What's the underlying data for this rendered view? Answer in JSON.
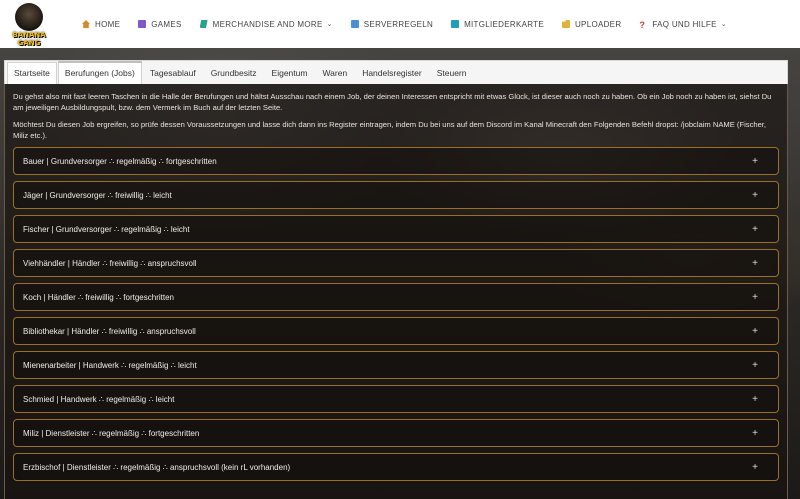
{
  "brand": {
    "logo_text": "BANANA GANG"
  },
  "nav": {
    "items": [
      {
        "label": "HOME",
        "icon": "home-icon"
      },
      {
        "label": "GAMES",
        "icon": "games-icon"
      },
      {
        "label": "MERCHANDISE AND MORE",
        "icon": "merch-icon",
        "dropdown": true
      },
      {
        "label": "SERVERREGELN",
        "icon": "rules-icon"
      },
      {
        "label": "MITGLIEDERKARTE",
        "icon": "map-icon"
      },
      {
        "label": "UPLOADER",
        "icon": "folder-icon"
      },
      {
        "label": "FAQ UND HILFE",
        "icon": "question-icon",
        "dropdown": true
      }
    ]
  },
  "tabs": [
    {
      "label": "Startseite"
    },
    {
      "label": "Berufungen (Jobs)"
    },
    {
      "label": "Tagesablauf"
    },
    {
      "label": "Grundbesitz"
    },
    {
      "label": "Eigentum"
    },
    {
      "label": "Waren"
    },
    {
      "label": "Handelsregister"
    },
    {
      "label": "Steuern"
    }
  ],
  "intro": {
    "p1": "Du gehst also mit fast leeren Taschen in die Halle der Berufungen und hältst Ausschau nach einem Job, der deinen Interessen entspricht mit etwas Glück, ist dieser auch noch zu haben. Ob ein Job noch zu haben ist, siehst Du am jeweiligen Ausbildungspult, bzw. dem Vermerk im Buch auf der letzten Seite.",
    "p2": "Möchtest Du diesen Job ergreifen, so prüfe dessen Voraussetzungen und lasse dich dann ins Register eintragen, indem Du bei uns auf dem Discord im Kanal Minecraft den Folgenden Befehl dropst: /jobclaim NAME (Fischer, Miliz etc.)."
  },
  "jobs": [
    {
      "label": "Bauer | Grundversorger ∴ regelmäßig ∴ fortgeschritten",
      "toggle": "+"
    },
    {
      "label": "Jäger | Grundversorger ∴ freiwillig ∴ leicht",
      "toggle": "+"
    },
    {
      "label": "Fischer | Grundversorger ∴ regelmäßig ∴ leicht",
      "toggle": "+"
    },
    {
      "label": "Viehhändler | Händler ∴ freiwillig ∴ anspruchsvoll",
      "toggle": "+"
    },
    {
      "label": "Koch | Händler ∴ freiwillig ∴ fortgeschritten",
      "toggle": "+"
    },
    {
      "label": "Bibliothekar | Händler ∴ freiwillig ∴ anspruchsvoll",
      "toggle": "+"
    },
    {
      "label": "Mienenarbeiter | Handwerk ∴ regelmäßig ∴ leicht",
      "toggle": "+"
    },
    {
      "label": "Schmied | Handwerk ∴ regelmäßig ∴ leicht",
      "toggle": "+"
    },
    {
      "label": "Miliz | Dienstleister ∴ regelmäßig ∴ fortgeschritten",
      "toggle": "+"
    },
    {
      "label": "Erzbischof | Dienstleister ∴ regelmäßig ∴ anspruchsvoll (kein rL vorhanden)",
      "toggle": "+"
    }
  ]
}
